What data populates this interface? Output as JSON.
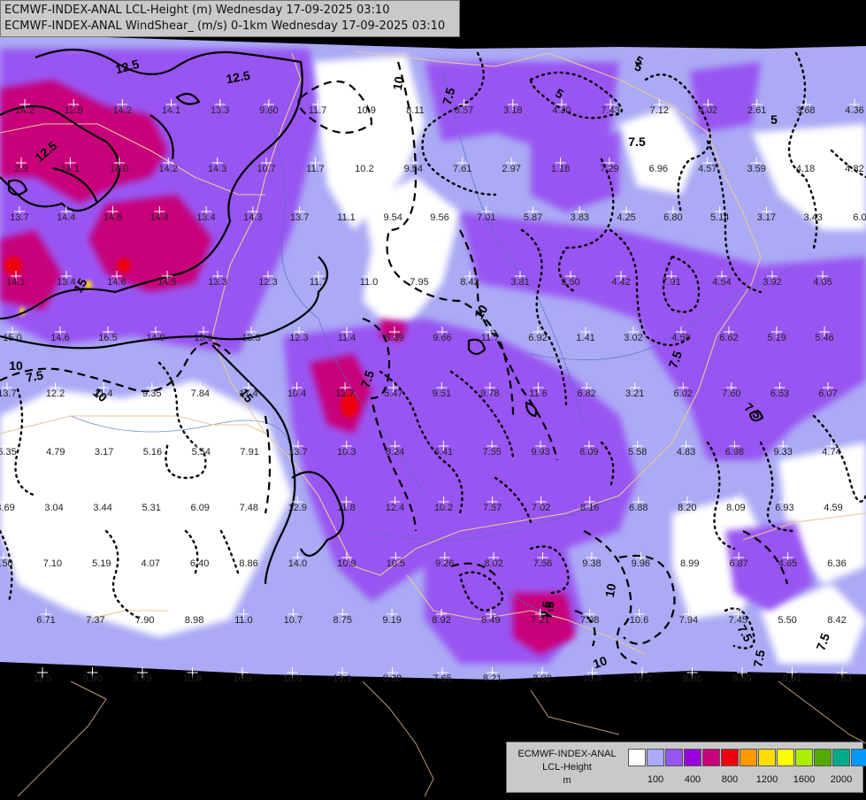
{
  "header": {
    "line1": "ECMWF-INDEX-ANAL LCL-Height (m) Wednesday 17-09-2025 03:10",
    "line2": "ECMWF-INDEX-ANAL WindShear_ (m/s) 0-1km Wednesday 17-09-2025 03:10"
  },
  "legend": {
    "line1": "ECMWF-INDEX-ANAL",
    "line2": "LCL-Height",
    "line3": "m",
    "colors": [
      "#ffffff",
      "#aaaaf5",
      "#9955f2",
      "#9900dd",
      "#c8007a",
      "#ee0010",
      "#ff9900",
      "#ffdd00",
      "#ffff00",
      "#aaee00",
      "#55aa00",
      "#00aa88",
      "#0099ff"
    ],
    "ticks": [
      {
        "label": "100",
        "at": 1
      },
      {
        "label": "400",
        "at": 3
      },
      {
        "label": "800",
        "at": 5
      },
      {
        "label": "1200",
        "at": 7
      },
      {
        "label": "1600",
        "at": 9
      },
      {
        "label": "2000",
        "at": 11
      }
    ]
  },
  "map": {
    "contour_labels": [
      "12.5",
      "12.5",
      "12.5",
      "10",
      "7.5",
      "5",
      "5",
      "7.5",
      "5",
      "7.5",
      "10",
      "15",
      "7.5",
      "10",
      "15",
      "7.5",
      "10",
      "7.5",
      "10",
      "10",
      "7.5",
      "7.5",
      "7.5",
      "7.5",
      "7.5",
      "5"
    ],
    "station_values": [
      "14.2",
      "12.9",
      "14.2",
      "14.1",
      "13.3",
      "9.60",
      "11.7",
      "10.9",
      "8.11",
      "8.57",
      "3.18",
      "4.30",
      "7.43",
      "7.12",
      "4.02",
      "2.61",
      "3.68",
      "4.36",
      "2.9",
      "14.1",
      "14.0",
      "14.2",
      "14.3",
      "10.7",
      "11.7",
      "10.2",
      "9.54",
      "7.61",
      "2.97",
      "1.18",
      "7.29",
      "6.96",
      "4.57",
      "3.59",
      "4.18",
      "4.82",
      "13.7",
      "14.4",
      "14.6",
      "14.4",
      "13.4",
      "14.3",
      "13.7",
      "11.1",
      "9.54",
      "9.56",
      "7.01",
      "5.87",
      "3.83",
      "4.25",
      "6.80",
      "5.14",
      "3.17",
      "3.43",
      "6.0",
      "14.1",
      "13.4",
      "14.6",
      "14.5",
      "13.3",
      "12.3",
      "11.7",
      "11.0",
      "7.95",
      "8.42",
      "3.81",
      "3.50",
      "4.42",
      "7.91",
      "4.54",
      "3.92",
      "4.05",
      "15.0",
      "14.6",
      "16.5",
      "14.9",
      "13.0",
      "13.3",
      "12.3",
      "11.4",
      "8.39",
      "9.66",
      "11.7",
      "6.92",
      "1.41",
      "3.02",
      "4.59",
      "6.62",
      "5.19",
      "5.46",
      "13.7",
      "12.2",
      "11.4",
      "9.35",
      "7.84",
      "17.4",
      "10.4",
      "12.7",
      "5.47",
      "9.51",
      "9.78",
      "11.6",
      "6.82",
      "3.21",
      "6.02",
      "7.60",
      "6.53",
      "6.07",
      "5.35",
      "4.79",
      "3.17",
      "5.16",
      "5.54",
      "7.91",
      "13.7",
      "10.3",
      "8.24",
      "6.41",
      "7.55",
      "9.93",
      "8.09",
      "5.58",
      "4.83",
      "6.98",
      "9.33",
      "4.74",
      "3.69",
      "3.04",
      "3.44",
      "5.31",
      "6.09",
      "7.48",
      "12.9",
      "11.8",
      "12.4",
      "10.2",
      "7.57",
      "7.02",
      "8.16",
      "6.88",
      "8.20",
      "8.09",
      "6.93",
      "4.59",
      "7.50",
      "7.10",
      "5.19",
      "4.07",
      "6.40",
      "8.86",
      "14.0",
      "10.9",
      "10.5",
      "9.26",
      "8.02",
      "7.56",
      "9.38",
      "9.96",
      "8.99",
      "6.87",
      "4.65",
      "6.36",
      "6.71",
      "7.37",
      "7.90",
      "8.98",
      "11.0",
      "10.7",
      "8.75",
      "9.19",
      "8.92",
      "8.49",
      "7.21",
      "7.08",
      "10.6",
      "7.94",
      "7.45",
      "5.50",
      "8.42",
      "11.5",
      "9.90",
      "9.79",
      "10.8",
      "10.3",
      "10.6",
      "10.1",
      "8.38",
      "7.65",
      "8.21",
      "8.92",
      "10.4",
      "10.2",
      "9.08",
      "9.69",
      "6.01",
      "7.63"
    ]
  }
}
